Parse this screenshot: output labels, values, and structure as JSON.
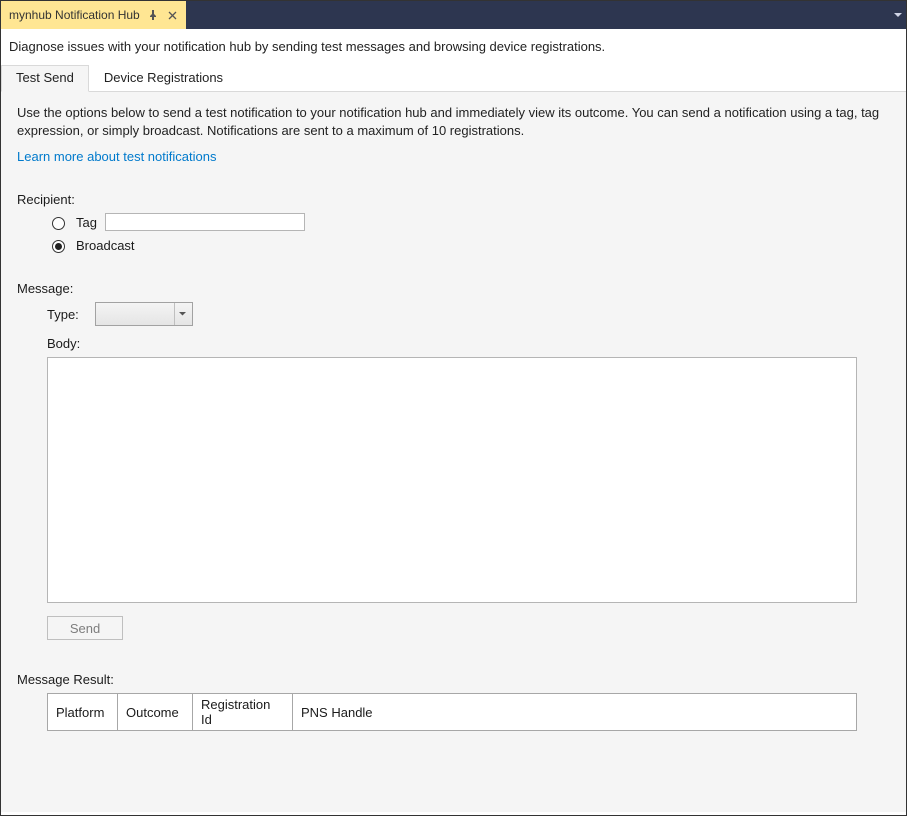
{
  "window": {
    "tab_title": "mynhub Notification Hub"
  },
  "description": "Diagnose issues with your notification hub by sending test messages and browsing device registrations.",
  "subtabs": {
    "test_send": "Test Send",
    "device_registrations": "Device Registrations"
  },
  "intro": "Use the options below to send a test notification to your notification hub and immediately view its outcome. You can send a notification using a tag, tag expression, or simply broadcast. Notifications are sent to a maximum of 10 registrations.",
  "learn_more": "Learn more about test notifications",
  "recipient": {
    "label": "Recipient:",
    "tag_label": "Tag",
    "tag_value": "",
    "broadcast_label": "Broadcast",
    "selected": "broadcast"
  },
  "message": {
    "label": "Message:",
    "type_label": "Type:",
    "type_value": "",
    "body_label": "Body:",
    "body_value": "",
    "send_label": "Send"
  },
  "result": {
    "label": "Message Result:",
    "columns": {
      "platform": "Platform",
      "outcome": "Outcome",
      "registration_id": "Registration Id",
      "pns_handle": "PNS Handle"
    }
  }
}
